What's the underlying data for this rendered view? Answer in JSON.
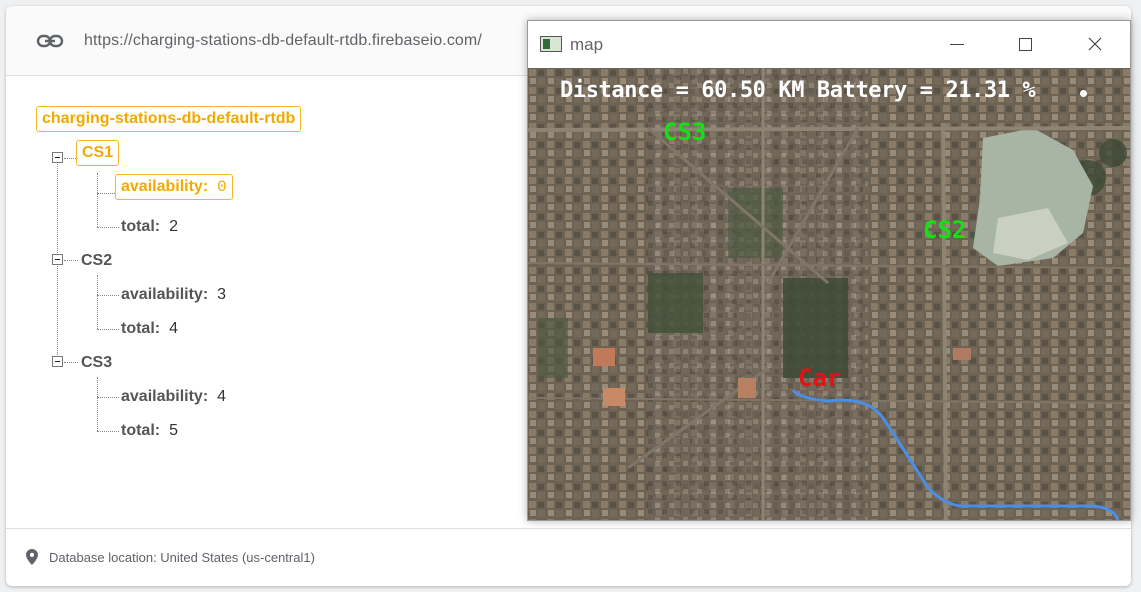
{
  "url": "https://charging-stations-db-default-rtdb.firebaseio.com/",
  "root": "charging-stations-db-default-rtdb",
  "stations": [
    {
      "name": "CS1",
      "availability_key": "availability:",
      "availability": "0",
      "total_key": "total:",
      "total": "2"
    },
    {
      "name": "CS2",
      "availability_key": "availability:",
      "availability": "3",
      "total_key": "total:",
      "total": "4"
    },
    {
      "name": "CS3",
      "availability_key": "availability:",
      "availability": "4",
      "total_key": "total:",
      "total": "5"
    }
  ],
  "footer": {
    "location": "Database location: United States (us-central1)",
    "icon": "location-pin-icon"
  },
  "map_window": {
    "title": "map",
    "status": "Distance = 60.50 KM  Battery = 21.31 %",
    "labels": {
      "cs1": "CS3",
      "cs2": "CS2",
      "car": "Car"
    },
    "colors": {
      "station_label": "#14e014",
      "car_label": "#e01414",
      "route": "#4a8ee8"
    }
  }
}
